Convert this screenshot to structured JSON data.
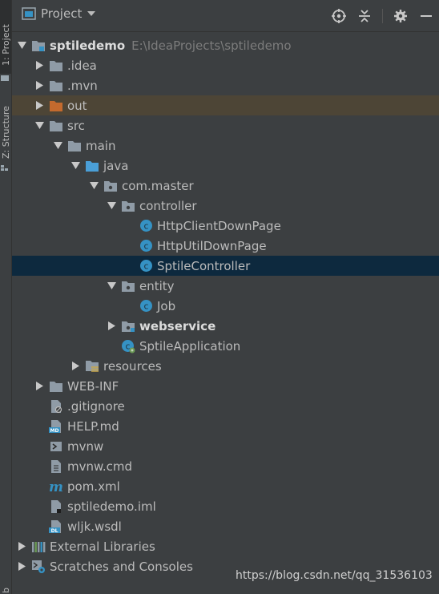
{
  "tool_strip": {
    "project_tab": "1: Project",
    "structure_tab": "Z: Structure",
    "bottom_letter": "b"
  },
  "header": {
    "title": "Project",
    "actions": [
      "locate-icon",
      "collapse-all-icon",
      "gear-icon",
      "minimize-icon"
    ]
  },
  "tree": [
    {
      "label": "sptiledemo",
      "path": "E:\\IdeaProjects\\sptiledemo",
      "icon": "module-folder-icon",
      "expanded": true
    },
    {
      "label": ".idea",
      "icon": "folder-icon",
      "expanded": false
    },
    {
      "label": ".mvn",
      "icon": "folder-icon",
      "expanded": false
    },
    {
      "label": "out",
      "icon": "excluded-folder-icon",
      "expanded": false
    },
    {
      "label": "src",
      "icon": "folder-icon",
      "expanded": true
    },
    {
      "label": "main",
      "icon": "folder-icon",
      "expanded": true
    },
    {
      "label": "java",
      "icon": "source-folder-icon",
      "expanded": true
    },
    {
      "label": "com.master",
      "icon": "package-icon",
      "expanded": true
    },
    {
      "label": "controller",
      "icon": "package-icon",
      "expanded": true
    },
    {
      "label": "HttpClientDownPage",
      "icon": "class-icon"
    },
    {
      "label": "HttpUtilDownPage",
      "icon": "class-icon"
    },
    {
      "label": "SptileController",
      "icon": "class-icon"
    },
    {
      "label": "entity",
      "icon": "package-icon",
      "expanded": true
    },
    {
      "label": "Job",
      "icon": "class-icon"
    },
    {
      "label": "webservice",
      "icon": "package-icon",
      "expanded": false
    },
    {
      "label": "SptileApplication",
      "icon": "spring-boot-class-icon"
    },
    {
      "label": "resources",
      "icon": "resources-folder-icon",
      "expanded": false
    },
    {
      "label": "WEB-INF",
      "icon": "folder-icon",
      "expanded": false
    },
    {
      "label": ".gitignore",
      "icon": "gitignore-file-icon"
    },
    {
      "label": "HELP.md",
      "icon": "markdown-file-icon"
    },
    {
      "label": "mvnw",
      "icon": "shell-script-icon"
    },
    {
      "label": "mvnw.cmd",
      "icon": "text-file-icon"
    },
    {
      "label": "pom.xml",
      "icon": "maven-icon"
    },
    {
      "label": "sptiledemo.iml",
      "icon": "iml-file-icon"
    },
    {
      "label": "wljk.wsdl",
      "icon": "wsdl-file-icon"
    },
    {
      "label": "External Libraries",
      "icon": "external-libraries-icon",
      "expanded": false
    },
    {
      "label": "Scratches and Consoles",
      "icon": "scratches-icon",
      "expanded": false
    }
  ],
  "watermark": "https://blog.csdn.net/qq_31536103",
  "colors": {
    "background": "#3c3f41",
    "selection": "#0d293e",
    "excluded_highlight": "#4d4536",
    "folder": "#8f9ba6",
    "source_folder": "#4a9fd8",
    "excluded_folder": "#c36a2e",
    "class_icon": "#3592c4"
  }
}
